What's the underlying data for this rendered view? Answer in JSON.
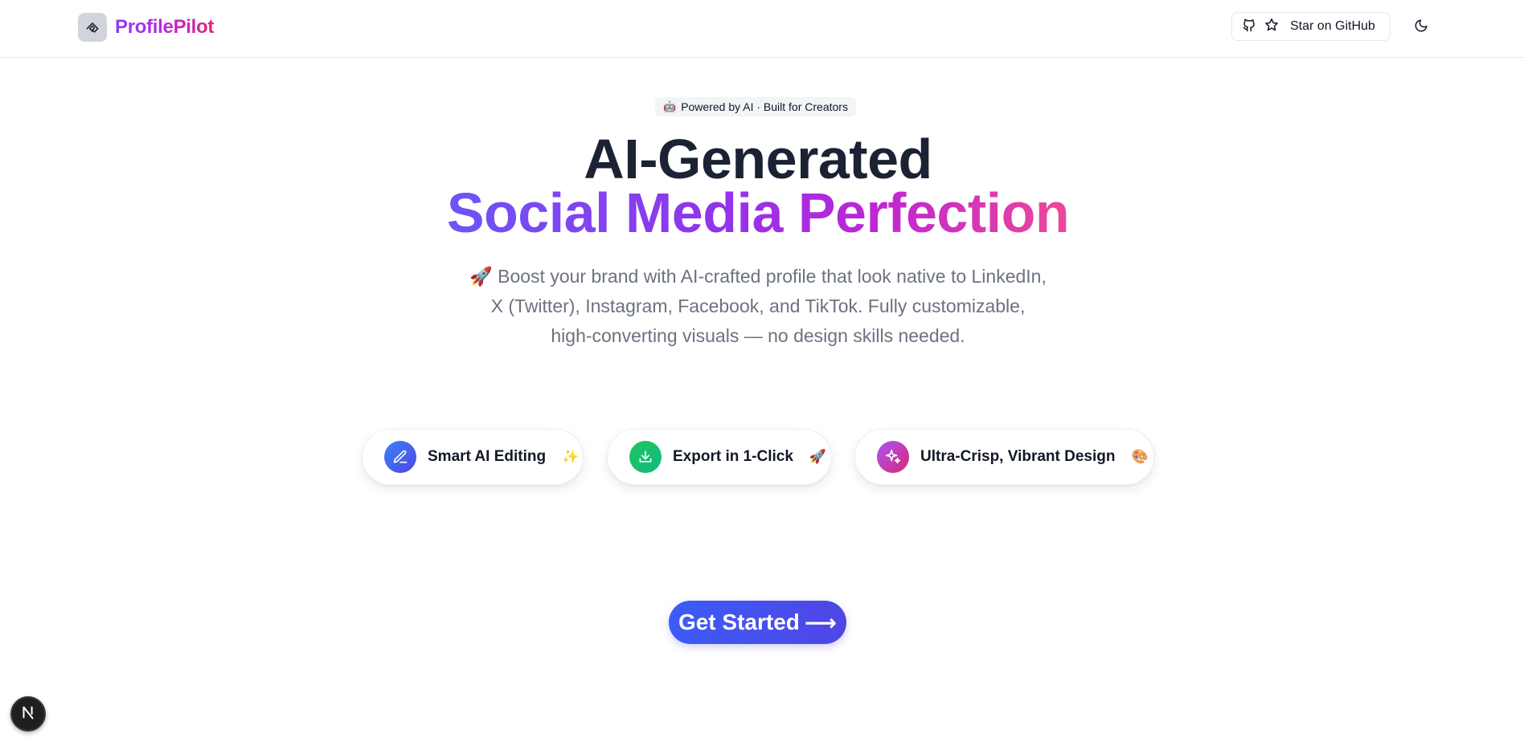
{
  "header": {
    "brand_name": "ProfilePilot",
    "github_label": "Star on GitHub"
  },
  "hero": {
    "badge_icon": "🤖",
    "badge_text": "Powered by AI · Built for Creators",
    "title_line1": "AI-Generated",
    "title_line2": "Social Media Perfection",
    "subtitle": "🚀 Boost your brand with AI-crafted profile that look native to LinkedIn, X (Twitter), Instagram, Facebook, and TikTok. Fully customizable, high-converting visuals — no design skills needed."
  },
  "features": [
    {
      "label": "Smart AI Editing",
      "emoji": "✨",
      "icon": "pencil-icon",
      "color": "#4f46e5"
    },
    {
      "label": "Export in 1-Click",
      "emoji": "🚀",
      "icon": "download-icon",
      "color": "#10b981"
    },
    {
      "label": "Ultra-Crisp, Vibrant Design",
      "emoji": "🎨",
      "icon": "sparkles-icon",
      "color": "#c026d3"
    }
  ],
  "cta": {
    "label": "Get Started",
    "arrow": "⟶"
  },
  "dev_badge": {
    "letter": "N"
  }
}
